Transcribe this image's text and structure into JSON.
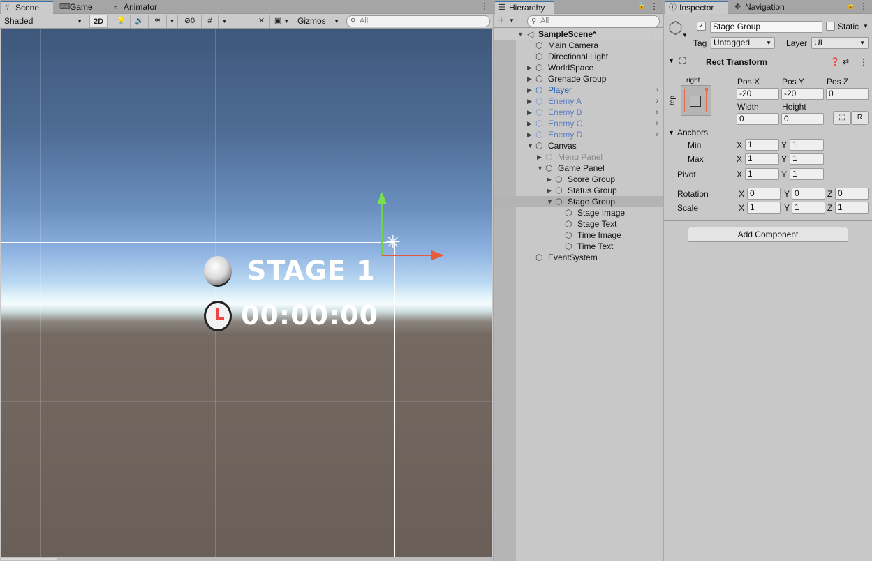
{
  "scene_panel": {
    "tabs": [
      {
        "label": "Scene",
        "icon": "grid-icon"
      },
      {
        "label": "Game",
        "icon": "gamepad-icon"
      },
      {
        "label": "Animator",
        "icon": "animator-icon"
      }
    ],
    "toolbar": {
      "draw_mode": "Shaded",
      "mode_2d": "2D",
      "hidden_count": "0",
      "gizmos_label": "Gizmos",
      "search_placeholder": "All"
    },
    "viewport": {
      "stage_text": "STAGE 1",
      "time_text": "00:00:00"
    }
  },
  "hierarchy": {
    "tab_label": "Hierarchy",
    "search_placeholder": "All",
    "scene_name": "SampleScene*",
    "items": [
      {
        "label": "Main Camera",
        "depth": 1,
        "arrow": "",
        "style": "normal"
      },
      {
        "label": "Directional Light",
        "depth": 1,
        "arrow": "",
        "style": "normal"
      },
      {
        "label": "WorldSpace",
        "depth": 1,
        "arrow": "collapsed",
        "style": "normal"
      },
      {
        "label": "Grenade Group",
        "depth": 1,
        "arrow": "collapsed",
        "style": "normal"
      },
      {
        "label": "Player",
        "depth": 1,
        "arrow": "collapsed",
        "style": "prefab",
        "chevron": true
      },
      {
        "label": "Enemy A",
        "depth": 1,
        "arrow": "collapsed",
        "style": "prefab-dim",
        "chevron": true
      },
      {
        "label": "Enemy B",
        "depth": 1,
        "arrow": "collapsed",
        "style": "prefab-dim",
        "chevron": true
      },
      {
        "label": "Enemy C",
        "depth": 1,
        "arrow": "collapsed",
        "style": "prefab-dim",
        "chevron": true
      },
      {
        "label": "Enemy D",
        "depth": 1,
        "arrow": "collapsed",
        "style": "prefab-dim",
        "chevron": true
      },
      {
        "label": "Canvas",
        "depth": 1,
        "arrow": "expanded",
        "style": "normal"
      },
      {
        "label": "Menu Panel",
        "depth": 2,
        "arrow": "collapsed",
        "style": "disabled"
      },
      {
        "label": "Game Panel",
        "depth": 2,
        "arrow": "expanded",
        "style": "normal"
      },
      {
        "label": "Score Group",
        "depth": 3,
        "arrow": "collapsed",
        "style": "normal"
      },
      {
        "label": "Status Group",
        "depth": 3,
        "arrow": "collapsed",
        "style": "normal"
      },
      {
        "label": "Stage Group",
        "depth": 3,
        "arrow": "expanded",
        "style": "normal",
        "selected": true
      },
      {
        "label": "Stage Image",
        "depth": 4,
        "arrow": "",
        "style": "normal"
      },
      {
        "label": "Stage Text",
        "depth": 4,
        "arrow": "",
        "style": "normal"
      },
      {
        "label": "Time Image",
        "depth": 4,
        "arrow": "",
        "style": "normal"
      },
      {
        "label": "Time Text",
        "depth": 4,
        "arrow": "",
        "style": "normal"
      },
      {
        "label": "EventSystem",
        "depth": 1,
        "arrow": "",
        "style": "normal"
      }
    ]
  },
  "inspector": {
    "tabs": [
      {
        "label": "Inspector",
        "icon": "info-icon"
      },
      {
        "label": "Navigation",
        "icon": "navigation-icon"
      }
    ],
    "object_name": "Stage Group",
    "active": true,
    "static_label": "Static",
    "tag_label": "Tag",
    "tag_value": "Untagged",
    "layer_label": "Layer",
    "layer_value": "UI",
    "rect_transform": {
      "title": "Rect Transform",
      "anchor_h": "right",
      "anchor_v": "top",
      "pos_x_label": "Pos X",
      "pos_x": "-20",
      "pos_y_label": "Pos Y",
      "pos_y": "-20",
      "pos_z_label": "Pos Z",
      "pos_z": "0",
      "width_label": "Width",
      "width": "0",
      "height_label": "Height",
      "height": "0",
      "raw_edit_label": "R",
      "anchors_label": "Anchors",
      "min_label": "Min",
      "min_x": "1",
      "min_y": "1",
      "max_label": "Max",
      "max_x": "1",
      "max_y": "1",
      "pivot_label": "Pivot",
      "pivot_x": "1",
      "pivot_y": "1",
      "rotation_label": "Rotation",
      "rot_x": "0",
      "rot_y": "0",
      "rot_z": "0",
      "scale_label": "Scale",
      "scale_x": "1",
      "scale_y": "1",
      "scale_z": "1",
      "x": "X",
      "y": "Y",
      "z": "Z"
    },
    "add_component": "Add Component"
  }
}
